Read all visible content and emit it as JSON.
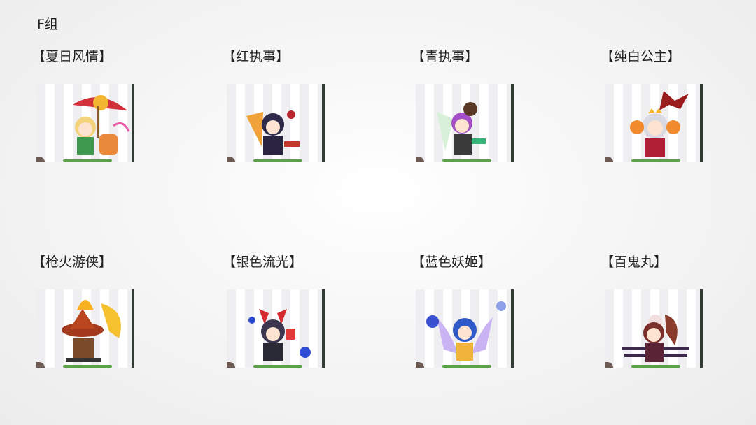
{
  "group_title": "F组",
  "skins": [
    {
      "name": "【夏日风情】",
      "icon": "summer-character-icon"
    },
    {
      "name": "【红执事】",
      "icon": "red-butler-character-icon"
    },
    {
      "name": "【青执事】",
      "icon": "cyan-butler-character-icon"
    },
    {
      "name": "【纯白公主】",
      "icon": "white-princess-character-icon"
    },
    {
      "name": "【枪火游侠】",
      "icon": "gunfire-ranger-character-icon"
    },
    {
      "name": "【银色流光】",
      "icon": "silver-streak-character-icon"
    },
    {
      "name": "【蓝色妖姬】",
      "icon": "blue-enchantress-character-icon"
    },
    {
      "name": "【百鬼丸】",
      "icon": "hyakkimaru-character-icon"
    }
  ]
}
